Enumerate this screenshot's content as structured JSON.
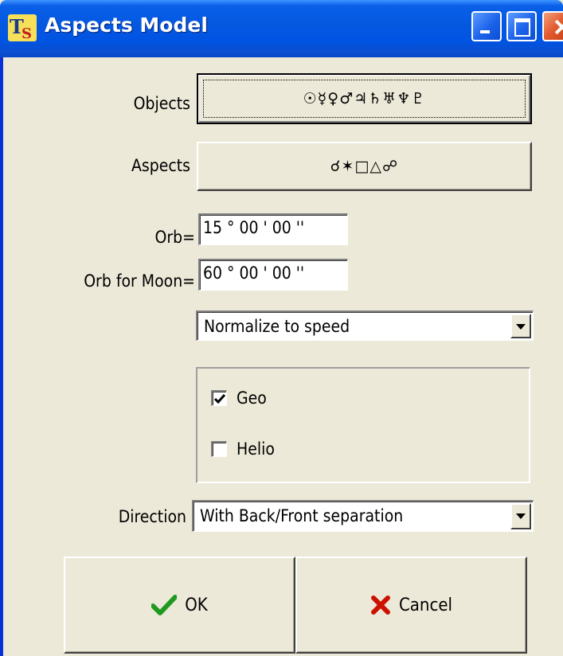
{
  "window": {
    "title": "Aspects Model",
    "app_icon": "ts-logo-icon",
    "controls": [
      "minimize-icon",
      "maximize-icon",
      "close-icon"
    ]
  },
  "objects": {
    "label": "Objects",
    "button_glyphs": "☉☿♀♂♃♄♅♆♇"
  },
  "aspects": {
    "label": "Aspects",
    "button_glyphs": "☌✶□△☍"
  },
  "orb": {
    "label": "Orb=",
    "value": "15 ° 00 ' 00 ''"
  },
  "orb_moon": {
    "label": "Orb for Moon=",
    "value": "60 ° 00 ' 00 ''"
  },
  "normalize": {
    "selected": "Normalize to speed"
  },
  "coordinates": {
    "options": [
      {
        "label": "Geo",
        "checked": true
      },
      {
        "label": "Helio",
        "checked": false
      }
    ]
  },
  "direction": {
    "label": "Direction",
    "selected": "With Back/Front separation"
  },
  "buttons": {
    "ok": {
      "label": "OK",
      "icon": "checkmark-icon"
    },
    "cancel": {
      "label": "Cancel",
      "icon": "x-mark-icon"
    }
  },
  "colors": {
    "titlebar": "#0054e3",
    "dialog_bg": "#ece9d8",
    "check_green": "#1f9a1f",
    "cancel_red": "#cc1100"
  }
}
